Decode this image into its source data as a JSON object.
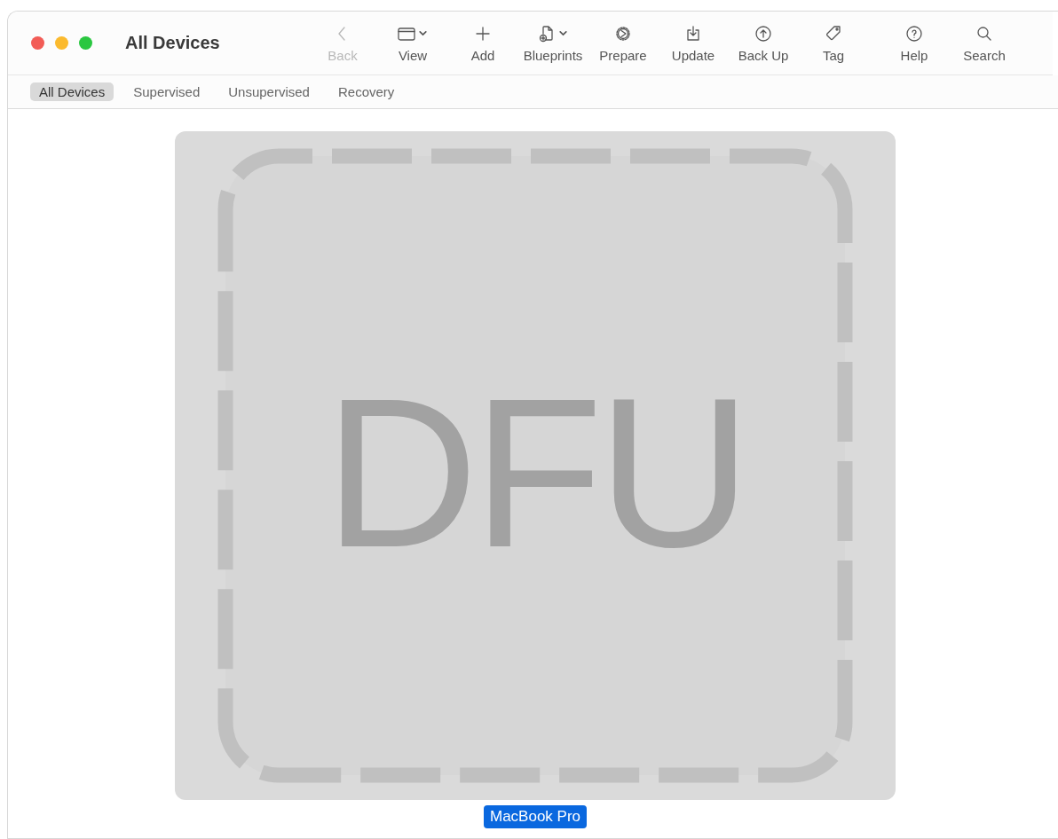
{
  "window": {
    "title": "All Devices"
  },
  "toolbar": [
    {
      "label": "Back",
      "disabled": true,
      "menu": false
    },
    {
      "label": "View",
      "disabled": false,
      "menu": true
    },
    {
      "label": "Add",
      "disabled": false,
      "menu": false
    },
    {
      "label": "Blueprints",
      "disabled": false,
      "menu": true
    },
    {
      "label": "Prepare",
      "disabled": false,
      "menu": false
    },
    {
      "label": "Update",
      "disabled": false,
      "menu": false
    },
    {
      "label": "Back Up",
      "disabled": false,
      "menu": false
    },
    {
      "label": "Tag",
      "disabled": false,
      "menu": false
    },
    {
      "label": "Help",
      "disabled": false,
      "menu": false
    },
    {
      "label": "Search",
      "disabled": false,
      "menu": false
    }
  ],
  "filters": [
    {
      "label": "All Devices",
      "selected": true
    },
    {
      "label": "Supervised",
      "selected": false
    },
    {
      "label": "Unsupervised",
      "selected": false
    },
    {
      "label": "Recovery",
      "selected": false
    }
  ],
  "devices": [
    {
      "name": "MacBook Pro",
      "badge": "DFU",
      "selected": true
    }
  ]
}
